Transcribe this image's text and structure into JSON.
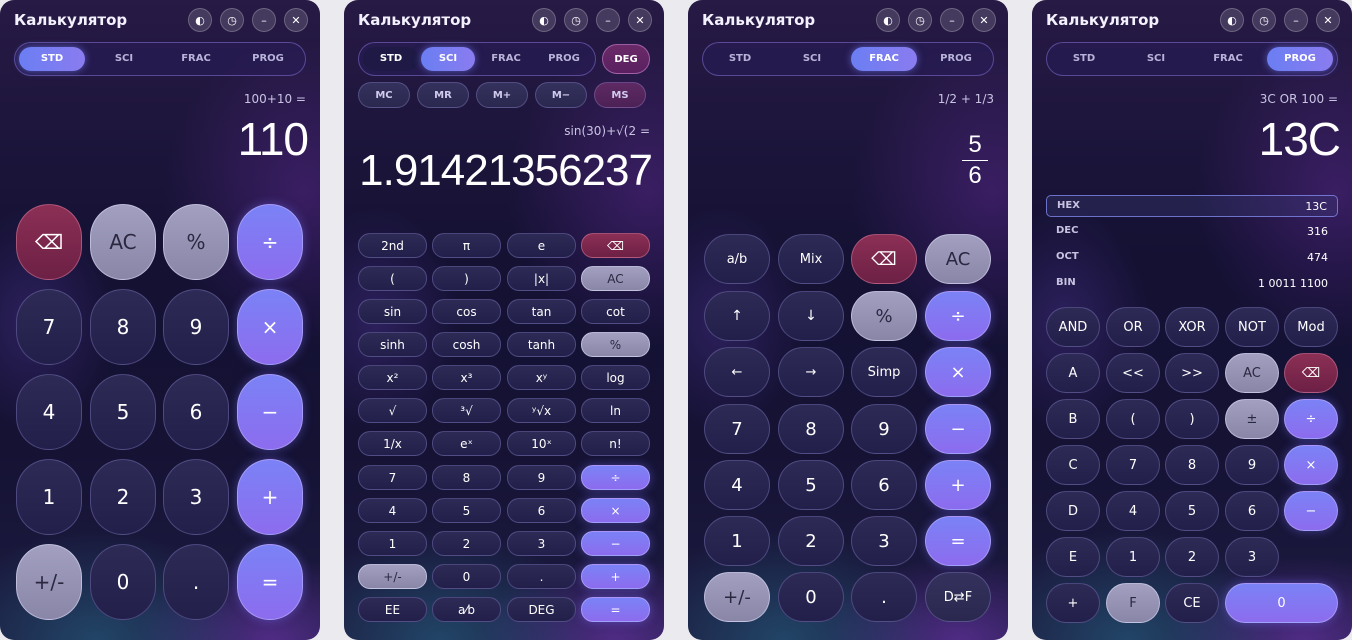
{
  "calculators": [
    {
      "title": "Калькулятор",
      "modes": [
        "STD",
        "SCI",
        "FRAC",
        "PROG"
      ],
      "active_mode": "STD",
      "expression": "100+10 =",
      "result": "110",
      "buttons": [
        "⌫",
        "AC",
        "%",
        "÷",
        "7",
        "8",
        "9",
        "×",
        "4",
        "5",
        "6",
        "−",
        "1",
        "2",
        "3",
        "+",
        "+/-",
        "0",
        ".",
        "="
      ]
    },
    {
      "title": "Калькулятор",
      "modes": [
        "STD",
        "SCI",
        "FRAC",
        "PROG"
      ],
      "active_mode": "SCI",
      "angle_mode": "DEG",
      "memory": [
        "MC",
        "MR",
        "M+",
        "M−",
        "MS"
      ],
      "expression": "sin(30)+√(2 =",
      "result": "1.91421356237",
      "buttons": [
        "2nd",
        "π",
        "e",
        "⌫",
        "(",
        ")",
        "|x|",
        "AC",
        "sin",
        "cos",
        "tan",
        "cot",
        "sinh",
        "cosh",
        "tanh",
        "%",
        "x²",
        "x³",
        "xʸ",
        "log",
        "√",
        "³√",
        "ʸ√x",
        "ln",
        "1/x",
        "eˣ",
        "10ˣ",
        "n!",
        "7",
        "8",
        "9",
        "÷",
        "4",
        "5",
        "6",
        "×",
        "1",
        "2",
        "3",
        "−",
        "+/-",
        "0",
        ".",
        "+",
        "EE",
        "a⁄b",
        "DEG",
        "="
      ]
    },
    {
      "title": "Калькулятор",
      "modes": [
        "STD",
        "SCI",
        "FRAC",
        "PROG"
      ],
      "active_mode": "FRAC",
      "expression": "1/2 + 1/3",
      "result_numerator": "5",
      "result_denominator": "6",
      "buttons": [
        "a/b",
        "Mix",
        "⌫",
        "AC",
        "↑",
        "↓",
        "%",
        "÷",
        "←",
        "→",
        "Simp",
        "×",
        "7",
        "8",
        "9",
        "−",
        "4",
        "5",
        "6",
        "+",
        "1",
        "2",
        "3",
        "=",
        "+/-",
        "0",
        ".",
        "D⇄F"
      ]
    },
    {
      "title": "Калькулятор",
      "modes": [
        "STD",
        "SCI",
        "FRAC",
        "PROG"
      ],
      "active_mode": "PROG",
      "expression": "3C OR 100 =",
      "result": "13C",
      "bases": [
        {
          "label": "HEX",
          "value": "13C"
        },
        {
          "label": "DEC",
          "value": "316"
        },
        {
          "label": "OCT",
          "value": "474"
        },
        {
          "label": "BIN",
          "value": "1 0011 1100"
        }
      ],
      "selected_base": "HEX",
      "buttons": [
        "AND",
        "OR",
        "XOR",
        "NOT",
        "Mod",
        "A",
        "<<",
        ">>",
        "AC",
        "⌫",
        "B",
        "(",
        ")",
        "±",
        "÷",
        "C",
        "7",
        "8",
        "9",
        "×",
        "D",
        "4",
        "5",
        "6",
        "−",
        "E",
        "1",
        "2",
        "3",
        "+",
        "F",
        "CE",
        "0",
        "="
      ]
    }
  ],
  "window_icons": [
    "palette-icon",
    "history-icon",
    "minimize-icon",
    "close-icon"
  ],
  "colors": {
    "accent": "#7b82f6",
    "delete": "#8c2f55",
    "light_key": "#a29fc0",
    "background": "#151234"
  }
}
